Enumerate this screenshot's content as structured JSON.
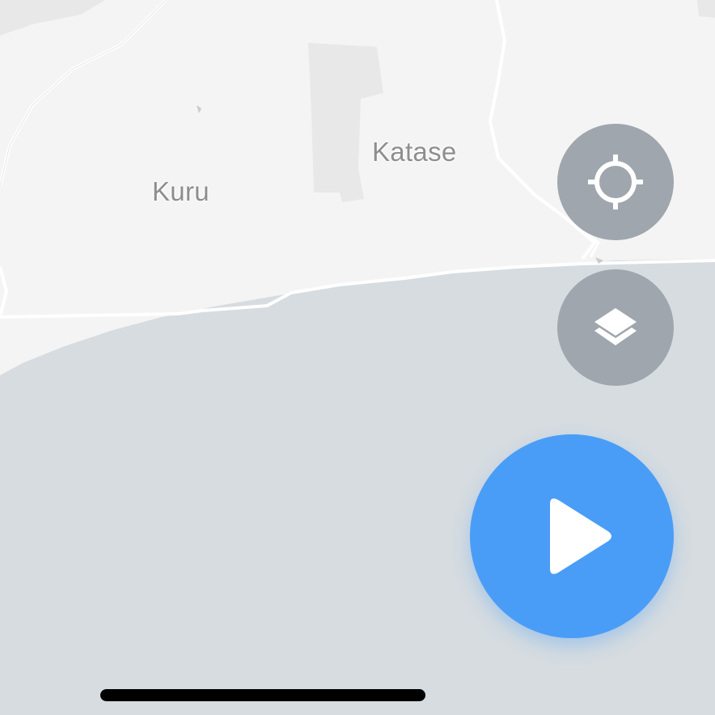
{
  "map": {
    "places": [
      {
        "name": "Kuru"
      },
      {
        "name": "Katase"
      }
    ],
    "colors": {
      "land": "#f4f4f4",
      "water": "#d6dce0",
      "building": "#e8e8e8",
      "road": "#ffffff"
    }
  },
  "controls": {
    "locate_icon": "crosshair-icon",
    "layers_icon": "layers-icon",
    "play_icon": "play-icon",
    "button_color": "#9fa6ad",
    "play_color": "#4a9df7"
  }
}
